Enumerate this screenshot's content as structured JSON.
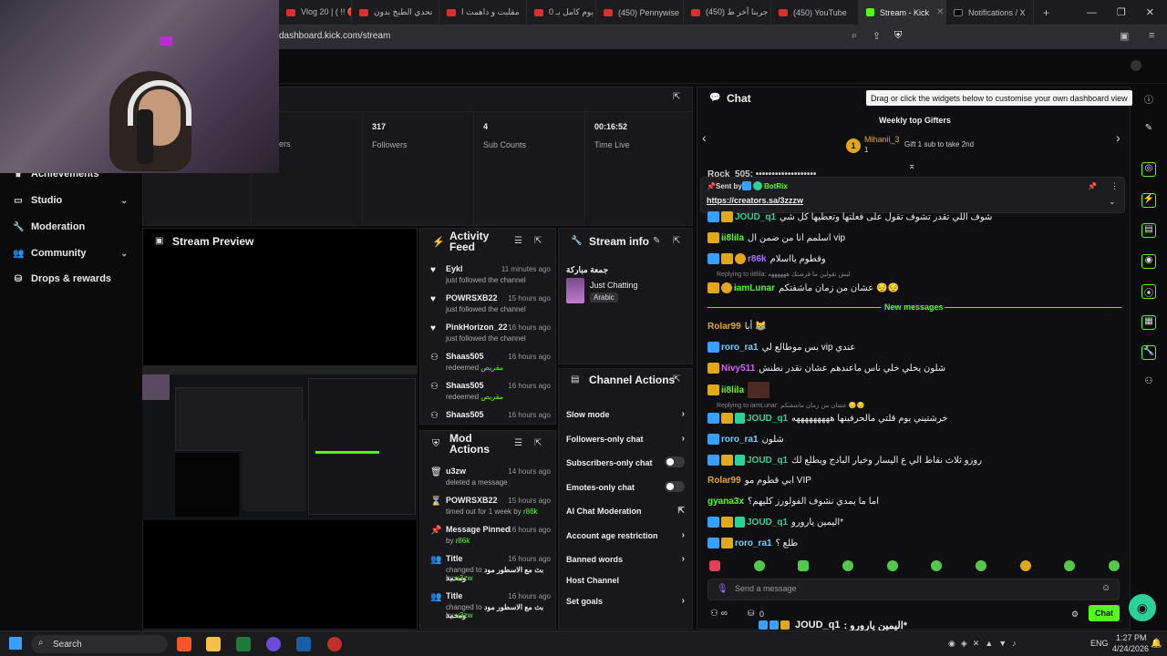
{
  "browser": {
    "tabs": [
      {
        "label": "Vlog 20 | ( !! 🔴 ك",
        "icon": "youtube-icon"
      },
      {
        "label": "تحدي الطبخ بدون",
        "icon": "youtube-icon"
      },
      {
        "label": "مقلبت و داهمت ا",
        "icon": "youtube-icon"
      },
      {
        "label": "عشنا يوم كامل بـ 0",
        "icon": "youtube-icon"
      },
      {
        "label": "(450) Pennywise",
        "icon": "youtube-icon"
      },
      {
        "label": "(450) جربنا آخر ط",
        "icon": "youtube-icon"
      },
      {
        "label": "(450) YouTube",
        "icon": "youtube-icon"
      },
      {
        "label": "Stream - Kick",
        "icon": "kick-icon",
        "active": true
      },
      {
        "label": "Notifications / X",
        "icon": "x-icon"
      }
    ],
    "new_tab": "+",
    "url": "dashboard.kick.com/stream"
  },
  "sidebar": {
    "items": [
      {
        "label": "Achievements",
        "icon": "trophy-icon"
      },
      {
        "label": "Studio",
        "icon": "monitor-icon",
        "chevron": true
      },
      {
        "label": "Moderation",
        "icon": "wrench-icon"
      },
      {
        "label": "Community",
        "icon": "people-icon",
        "chevron": true
      },
      {
        "label": "Drops & rewards",
        "icon": "gift-icon"
      }
    ]
  },
  "stats": {
    "partial_label": "ers",
    "items": [
      {
        "value": "317",
        "label": "Followers"
      },
      {
        "value": "4",
        "label": "Sub Counts"
      },
      {
        "value": "00:16:52",
        "label": "Time Live"
      }
    ]
  },
  "preview": {
    "title": "Stream Preview"
  },
  "activity": {
    "title": "Activity Feed",
    "items": [
      {
        "name": "Eykl",
        "time": "11 minutes ago",
        "sub": "just followed the channel",
        "icon": "heart-icon"
      },
      {
        "name": "POWRSXB22",
        "time": "15 hours ago",
        "sub": "just followed the channel",
        "icon": "heart-icon"
      },
      {
        "name": "PinkHorizon_22",
        "time": "16 hours ago",
        "sub": "just followed the channel",
        "icon": "heart-icon"
      },
      {
        "name": "Shaas505",
        "time": "16 hours ago",
        "sub": "redeemed",
        "reward": "مقريص",
        "icon": "points-icon"
      },
      {
        "name": "Shaas505",
        "time": "16 hours ago",
        "sub": "redeemed",
        "reward": "مقريص",
        "icon": "points-icon"
      },
      {
        "name": "Shaas505",
        "time": "16 hours ago",
        "sub": "",
        "icon": "points-icon"
      }
    ]
  },
  "mod_actions": {
    "title": "Mod Actions",
    "items": [
      {
        "name": "u3zw",
        "time": "14 hours ago",
        "sub": "deleted a message",
        "icon": "trash-icon"
      },
      {
        "name": "POWRSXB22",
        "time": "15 hours ago",
        "sub": "timed out for 1 week by",
        "by": "r86k",
        "icon": "hourglass-icon"
      },
      {
        "name": "Message Pinned",
        "time": "16 hours ago",
        "sub": "by",
        "by": "r86k",
        "icon": "pin-icon"
      },
      {
        "name": "Title",
        "time": "16 hours ago",
        "sub": "changed to",
        "value": "بث مع الاسطور مود ومحمد",
        "by": "u3zw",
        "icon": "people-icon"
      },
      {
        "name": "Title",
        "time": "16 hours ago",
        "sub": "changed to",
        "value": "بث مع الاسطور مود ومحمد",
        "by": "u3zw",
        "icon": "people-icon"
      }
    ]
  },
  "stream_info": {
    "title": "Stream info",
    "stream_title": "جمعة مباركة",
    "category": "Just Chatting",
    "tag": "Arabic"
  },
  "channel_actions": {
    "title": "Channel Actions",
    "items": [
      {
        "label": "Slow mode",
        "type": "arrow"
      },
      {
        "label": "Followers-only chat",
        "type": "arrow"
      },
      {
        "label": "Subscribers-only chat",
        "type": "toggle"
      },
      {
        "label": "Emotes-only chat",
        "type": "toggle"
      },
      {
        "label": "AI Chat Moderation",
        "type": "external"
      },
      {
        "label": "Account age restriction",
        "type": "arrow"
      },
      {
        "label": "Banned words",
        "type": "arrow"
      },
      {
        "label": "Host Channel",
        "type": "none"
      },
      {
        "label": "Set goals",
        "type": "arrow"
      }
    ]
  },
  "chat": {
    "title": "Chat",
    "tooltip": "Drag or click the widgets below to customise your own dashboard view",
    "gifters_title": "Weekly top Gifters",
    "top_gifter": {
      "name": "Mihanii_3",
      "count": "1",
      "rank": "1",
      "hint": "Gift 1 sub to take 2nd"
    },
    "pinned": {
      "sent_by_label": "Sent by",
      "sender": "BotRix",
      "link": "https://creators.sa/3zzzw"
    },
    "partial_top": "Rock_505: •••••••••••••••••••",
    "messages": [
      {
        "user": "JOUD_q1",
        "text": "شوف اللي تقدر تشوف تقول على فعلتها وتعطيها كل شي",
        "color": "#2bd39a",
        "badges": [
          "mod",
          "crown"
        ]
      },
      {
        "user": "ii8lila",
        "text": "اسلمم انا من ضمن ال vip",
        "color": "#53fc18",
        "badges": [
          "crown"
        ]
      },
      {
        "user": "r86k",
        "text": "وقطوم يااسلام",
        "color": "#a970ff",
        "badges": [
          "mod",
          "crown",
          "lv"
        ]
      },
      {
        "user": "iamLunar",
        "text": "عشان من زمان ماشفتكم 😔😔",
        "color": "#53fc18",
        "badges": [
          "crown",
          "lv"
        ],
        "reply": "Replying to ii8lila: ليش تقولين ما قرصتك ههههههه"
      },
      {
        "user": "Rolar99",
        "text": "أبا 😹",
        "color": "#e0a81a",
        "badges": []
      },
      {
        "user": "roro_ra1",
        "text": "بس موطالع لي vip عندي",
        "color": "#6fd0ff",
        "badges": [
          "mod"
        ]
      },
      {
        "user": "Nivy511",
        "text": "شلون يخلي خلي ناس ماعندهم عشان نقدر نطنش",
        "color": "#d95ff5",
        "badges": [
          "crown"
        ]
      },
      {
        "user": "ii8lila",
        "text": "🖼",
        "color": "#53fc18",
        "badges": [
          "crown"
        ]
      },
      {
        "user": "JOUD_q1",
        "text": "خرشتيني يوم قلتي مالحرفينها هههههههههه",
        "color": "#2bd39a",
        "badges": [
          "mod",
          "crown",
          "sub"
        ],
        "reply": "Replying to iamLunar: عشان من زمان ماشفتكم 😔😔"
      },
      {
        "user": "roro_ra1",
        "text": "شلون",
        "color": "#6fd0ff",
        "badges": [
          "mod"
        ]
      },
      {
        "user": "JOUD_q1",
        "text": "روزو ثلاث نقاط الي ع اليسار وخيار البادج ويطلع لك",
        "color": "#2bd39a",
        "badges": [
          "mod",
          "crown",
          "sub"
        ]
      },
      {
        "user": "Rolar99",
        "text": "ابي قطوم مو VIP",
        "color": "#e0a81a",
        "badges": []
      },
      {
        "user": "gyana3x",
        "text": "اما ما يمدي نشوف الفولورز كليهم؟",
        "color": "#53fc18",
        "badges": []
      },
      {
        "user": "JOUD_q1",
        "text": "اليمين يارورو*",
        "color": "#2bd39a",
        "badges": [
          "mod",
          "crown",
          "sub"
        ]
      },
      {
        "user": "roro_ra1",
        "text": "طلع ؟",
        "color": "#6fd0ff",
        "badges": [
          "mod",
          "crown"
        ]
      }
    ],
    "new_messages_label": "New messages",
    "input_placeholder": "Send a message",
    "send_label": "Chat",
    "viewers": "0",
    "overlay_user": "JOUD_q1",
    "overlay_text": ": اليمين يارورو*"
  },
  "taskbar": {
    "search_label": "Search",
    "lang": "ENG",
    "time": "1:27 PM",
    "date": "4/24/2026"
  }
}
